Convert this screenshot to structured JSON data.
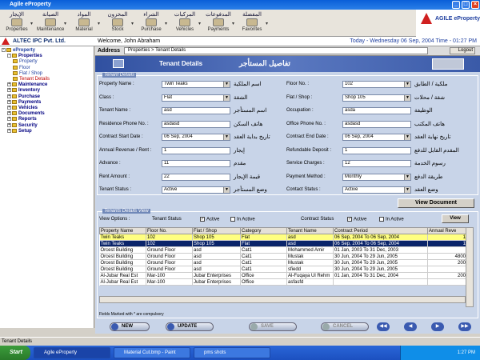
{
  "window": {
    "title": "Agile eProperty",
    "minimize": "_",
    "maximize": "□",
    "close": "×"
  },
  "toolbar": {
    "items": [
      {
        "ar": "الإيجار",
        "en": "Properties"
      },
      {
        "ar": "الصيانة",
        "en": "Maintenance"
      },
      {
        "ar": "المواد",
        "en": "Material"
      },
      {
        "ar": "المخزون",
        "en": "Stock"
      },
      {
        "ar": "الشراء",
        "en": "Purchase"
      },
      {
        "ar": "المركبات",
        "en": "Vehicles"
      },
      {
        "ar": "المدفوعات",
        "en": "Payments"
      },
      {
        "ar": "المفضلة",
        "en": "Favorites"
      }
    ]
  },
  "logo": {
    "text": "AGILE eProperty"
  },
  "companybar": {
    "company": "ALTEC IPC Pvt. Ltd.",
    "welcome": "Welcome, John Abraham",
    "datetime": "Today - Wednesday 06 Sep, 2004    Time - 01:27 PM"
  },
  "addressbar": {
    "label": "Address",
    "path": "Properties > Tenant Details",
    "logout": "Logout"
  },
  "header": {
    "en": "Tenant Details",
    "ar": "تفاصيل المستأجر"
  },
  "tree": [
    {
      "label": "eProperty",
      "level": 0,
      "sign": "-"
    },
    {
      "label": "Properties",
      "level": 1,
      "sign": "-"
    },
    {
      "label": "Property",
      "level": 2,
      "sign": ""
    },
    {
      "label": "Floor",
      "level": 2,
      "sign": ""
    },
    {
      "label": "Flat / Shop",
      "level": 2,
      "sign": ""
    },
    {
      "label": "Tenant Details",
      "level": 2,
      "sign": ""
    },
    {
      "label": "Maintenance",
      "level": 1,
      "sign": "+"
    },
    {
      "label": "Inventory",
      "level": 1,
      "sign": "+"
    },
    {
      "label": "Purchase",
      "level": 1,
      "sign": "+"
    },
    {
      "label": "Payments",
      "level": 1,
      "sign": "+"
    },
    {
      "label": "Vehicles",
      "level": 1,
      "sign": "+"
    },
    {
      "label": "Documents",
      "level": 1,
      "sign": "+"
    },
    {
      "label": "Reports",
      "level": 1,
      "sign": "+"
    },
    {
      "label": "Security",
      "level": 1,
      "sign": "+"
    },
    {
      "label": "Setup",
      "level": 1,
      "sign": "+"
    }
  ],
  "form": {
    "group_title": "Tenant Details",
    "left": [
      {
        "label": "Property Name :",
        "ar": "اسم الملكية",
        "value": "Twin Teaks",
        "select": true
      },
      {
        "label": "Class :",
        "ar": "الشقة",
        "value": "Flat",
        "select": true
      },
      {
        "label": "Tenant Name :",
        "ar": "اسم المستأجر",
        "value": "asd",
        "select": false
      },
      {
        "label": "Residence Phone No. :",
        "ar": "هاتف السكن",
        "value": "asdasd",
        "select": false
      },
      {
        "label": "Contract Start Date :",
        "ar": "تاريخ بداية العقد",
        "value": "06 Sep, 2004",
        "select": true
      },
      {
        "label": "Annual Revenue / Rent :",
        "ar": "إيجار",
        "value": "1",
        "select": false
      },
      {
        "label": "Advance :",
        "ar": "مقدم",
        "value": "11",
        "select": false
      },
      {
        "label": "Rent Amount :",
        "ar": "قيمة الإيجار",
        "value": "22",
        "select": false
      },
      {
        "label": "Tenant Status :",
        "ar": "وضع المستأجر",
        "value": "Active",
        "select": true
      }
    ],
    "right": [
      {
        "label": "Floor No. :",
        "ar": "ملكية / الطابق",
        "value": "102",
        "select": true
      },
      {
        "label": "Flat / Shop :",
        "ar": "شقة / محلات",
        "value": "Shop 105",
        "select": true
      },
      {
        "label": "Occupation :",
        "ar": "الوظيفة",
        "value": "asda",
        "select": false
      },
      {
        "label": "Office Phone No. :",
        "ar": "هاتف المكتب",
        "value": "asdasd",
        "select": false
      },
      {
        "label": "Contract End Date :",
        "ar": "تاريخ نهاية العقد",
        "value": "06 Sep, 2004",
        "select": true
      },
      {
        "label": "Refundable Deposit :",
        "ar": "المقدم القابل للدفع",
        "value": "1",
        "select": false
      },
      {
        "label": "Service Charges :",
        "ar": "رسوم الخدمة",
        "value": "12",
        "select": false
      },
      {
        "label": "Payment Method :",
        "ar": "طريقة الدفع",
        "value": "Monthly",
        "select": true
      },
      {
        "label": "Contact Status :",
        "ar": "وضع العقد",
        "value": "Active",
        "select": true
      }
    ],
    "view_document": "View Document"
  },
  "view": {
    "group_title": "Tenants Details View",
    "options_label": "View Options :",
    "tenant_status_label": "Tenant Status",
    "contract_status_label": "Contract Status",
    "active": "Active",
    "inactive": "In Active",
    "view_button": "View"
  },
  "grid": {
    "columns": [
      "Property Name",
      "Floor No.",
      "Flat / Shop",
      "Category",
      "Tenant Name",
      "Contract Period",
      "Annual Reve"
    ],
    "rows": [
      [
        "Twin Teaks",
        "102",
        "Shop 105",
        "Flat",
        "asd",
        "06 Sep, 2004 To 06 Sep, 2004",
        "1"
      ],
      [
        "Twin Teaks",
        "102",
        "Shop 105",
        "Flat",
        "asd",
        "06 Sep, 2004 To 06 Sep, 2004",
        "1"
      ],
      [
        "Orcest Building",
        "Ground Floor",
        "asd",
        "Cat1",
        "Mohammed Amir",
        "01 Jan, 2003 To 31 Dec, 2003",
        ""
      ],
      [
        "Orcest Building",
        "Ground Floor",
        "asd",
        "Cat1",
        "Mustak",
        "30 Jun, 2004 To 29 Jun, 2005",
        "4800"
      ],
      [
        "Orcest Building",
        "Ground Floor",
        "asd",
        "Cat1",
        "Mustak",
        "30 Jun, 2004 To 29 Jun, 2005",
        "200"
      ],
      [
        "Orcest Building",
        "Ground Floor",
        "asd",
        "Cat1",
        "sfiedd",
        "30 Jun, 2004 To 29 Jun, 2005",
        ""
      ],
      [
        "Al-Jubar Real Est",
        "Mar-100",
        "Jubar Enterprises",
        "Office",
        "Al-Fuqaya Ul Rehm",
        "01 Jan, 2004 To 31 Dec, 2004",
        "200"
      ],
      [
        "Al-Jubar Real Est",
        "Mar-100",
        "Jubar Enterprises",
        "Office",
        "asfasfd",
        "",
        ""
      ]
    ]
  },
  "mandatory_note": "Fields Marked with * are compulsory",
  "nav": {
    "new": "NEW",
    "update": "UPDATE",
    "save": "SAVE",
    "cancel": "CANCEL",
    "first": "◀◀",
    "prev": "◀",
    "next": "▶",
    "last": "▶▶"
  },
  "statusbar": {
    "text": "Tenant Details"
  },
  "taskbar": {
    "start": "Start",
    "tasks": [
      "Agile eProperty",
      "Material Cut.bmp - Paint",
      "pms shots"
    ],
    "clock": "1:27 PM"
  }
}
